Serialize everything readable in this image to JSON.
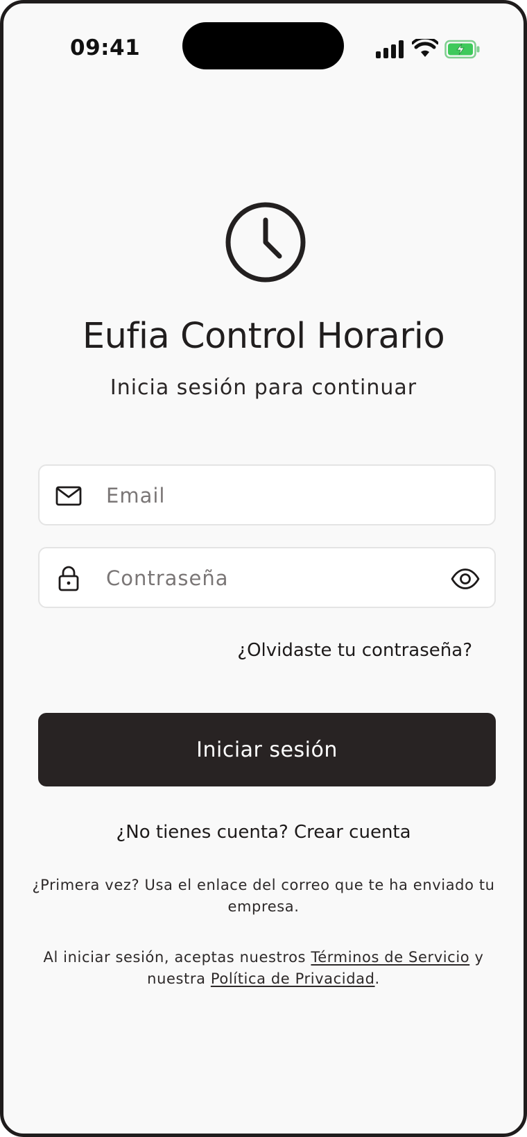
{
  "status_bar": {
    "time": "09:41",
    "icons": [
      "cellular-signal-icon",
      "wifi-icon",
      "battery-charging-icon"
    ],
    "battery_color": "#3ec95b"
  },
  "app": {
    "logo_icon": "clock-icon",
    "title": "Eufia Control Horario",
    "subtitle": "Inicia sesión para continuar"
  },
  "form": {
    "email": {
      "icon": "envelope-icon",
      "placeholder": "Email",
      "value": ""
    },
    "password": {
      "icon": "lock-icon",
      "placeholder": "Contraseña",
      "value": "",
      "toggle_icon": "eye-icon"
    },
    "forgot_label": "¿Olvidaste tu contraseña?",
    "submit_label": "Iniciar sesión"
  },
  "signup": {
    "text": "¿No tienes cuenta?",
    "link": "Crear cuenta"
  },
  "first_time": "¿Primera vez? Usa el enlace del correo que te ha enviado tu empresa.",
  "legal": {
    "prefix": "Al iniciar sesión, aceptas nuestros",
    "terms": "Términos de Servicio",
    "middle": "y nuestra",
    "privacy": "Política de Privacidad",
    "suffix": "."
  },
  "colors": {
    "background": "#f9f9f9",
    "primary": "#282323",
    "text": "#211e1e",
    "placeholder": "#7a7676"
  }
}
